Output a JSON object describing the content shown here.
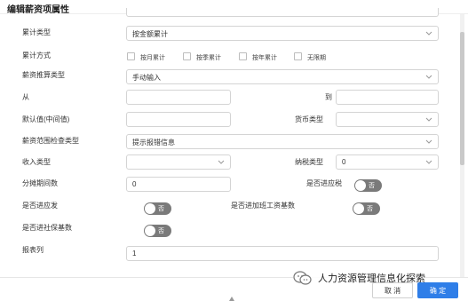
{
  "dialog": {
    "title": "编辑薪资项属性"
  },
  "form": {
    "accumulation_type": {
      "label": "累计类型",
      "value": "按金额累计"
    },
    "accumulation_method": {
      "label": "累计方式",
      "options": [
        "按月累计",
        "按季累计",
        "按年累计",
        "无限期"
      ]
    },
    "calc_type": {
      "label": "薪资推算类型",
      "value": "手动输入"
    },
    "from": {
      "label": "从",
      "value": ""
    },
    "to": {
      "label": "到",
      "value": ""
    },
    "default_value": {
      "label": "默认值(中间值)",
      "value": ""
    },
    "currency_type": {
      "label": "货币类型",
      "value": ""
    },
    "range_check_type": {
      "label": "薪资范围检查类型",
      "value": "提示报错信息"
    },
    "income_type": {
      "label": "收入类型",
      "value": ""
    },
    "tax_type": {
      "label": "纳税类型",
      "value": "0"
    },
    "amortization_periods": {
      "label": "分摊期间数",
      "value": "0"
    },
    "taxable": {
      "label": "是否进应税",
      "toggle_text": "否"
    },
    "payable": {
      "label": "是否进应发",
      "toggle_text": "否"
    },
    "overtime_base": {
      "label": "是否进加班工资基数",
      "toggle_text": "否"
    },
    "social_security_base": {
      "label": "是否进社保基数",
      "toggle_text": "否"
    },
    "report_column": {
      "label": "报表列",
      "value": "1"
    }
  },
  "footer": {
    "cancel_label": "取 消",
    "ok_label": "确 定"
  },
  "watermark": {
    "text": "人力资源管理信息化探索"
  }
}
